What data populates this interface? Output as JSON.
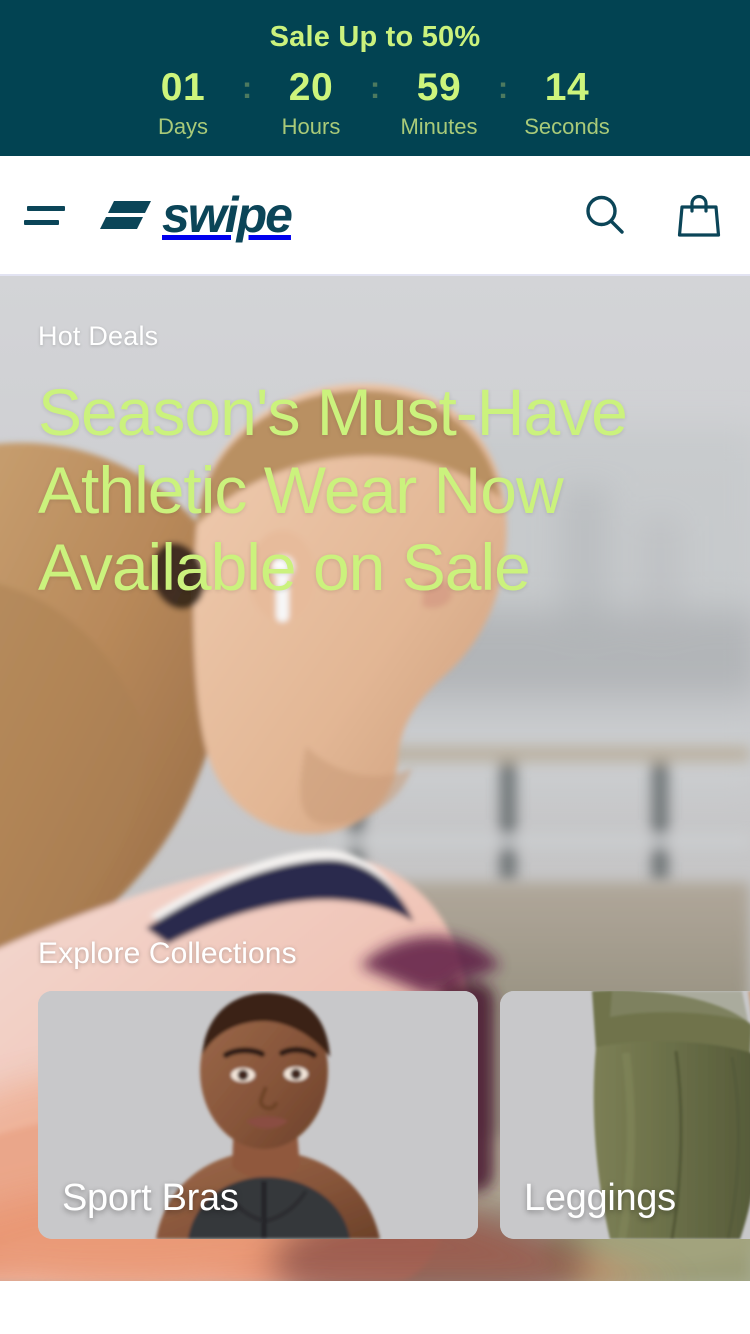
{
  "theme": {
    "teal": "#024352",
    "lime": "#cbf27d",
    "lime_bright": "#cdf57c",
    "lime_muted": "#a9ca79",
    "ink": "#0b4558",
    "white": "#ffffff",
    "border": "#e2e3f2",
    "card_bg": "#c8c8ca"
  },
  "announcement": {
    "title": "Sale Up to 50%",
    "separator": ":",
    "countdown": [
      {
        "value": "01",
        "label": "Days"
      },
      {
        "value": "20",
        "label": "Hours"
      },
      {
        "value": "59",
        "label": "Minutes"
      },
      {
        "value": "14",
        "label": "Seconds"
      }
    ]
  },
  "header": {
    "menu_icon": "hamburger-icon",
    "brand_name": "swipe",
    "brand_mark_icon": "swipe-logo-mark",
    "search_icon": "search-icon",
    "cart_icon": "shopping-bag-icon"
  },
  "hero": {
    "eyebrow": "Hot Deals",
    "title": "Season's Must-Have Athletic Wear Now Available on Sale",
    "title_lines": [
      "Season's Must-Have",
      "Athletic Wear Now",
      "Available on Sale"
    ]
  },
  "collections": {
    "heading": "Explore Collections",
    "items": [
      {
        "label": "Sport Bras"
      },
      {
        "label": "Leggings"
      }
    ]
  }
}
